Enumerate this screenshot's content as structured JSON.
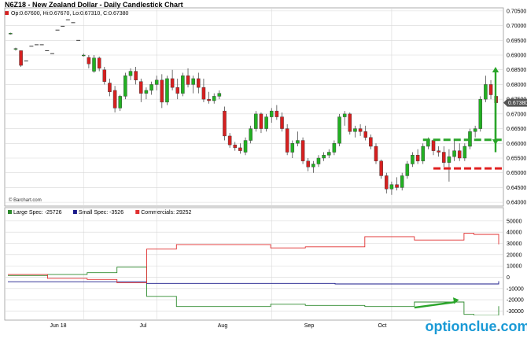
{
  "header": {
    "title": "N6Z18 - New Zealand Dollar - Daily Candlestick Chart",
    "ohlc": "Op:0.67600, Hi:0.67670, Lo:0.67310, C:0.67380"
  },
  "credit": "© Barchart.com",
  "watermark": {
    "main": "optionclue",
    "dot": ".",
    "tld": "com"
  },
  "colors": {
    "up": "#22b022",
    "down": "#d62020",
    "grid": "#d8d8d8",
    "large": "#2d8a2d",
    "small": "#1a1a8a",
    "commercials": "#e03030",
    "annotation_green": "#2aa52a",
    "annotation_red": "#e02020",
    "badge": "#555555"
  },
  "chart_data": [
    {
      "type": "candlestick",
      "title": "N6Z18 - New Zealand Dollar - Daily Candlestick Chart",
      "x_ticks": [
        "Jun 18",
        "Jul",
        "Aug",
        "Sep",
        "Oct"
      ],
      "y_ticks": [
        "0.70500",
        "0.70000",
        "0.69500",
        "0.69000",
        "0.68500",
        "0.68000",
        "0.67500",
        "0.67000",
        "0.66500",
        "0.66000",
        "0.65500",
        "0.65000",
        "0.64500",
        "0.64000"
      ],
      "ylim": [
        0.6395,
        0.7055
      ],
      "last_price": "0.67380",
      "candles": [
        {
          "o": 0.6972,
          "h": 0.6976,
          "l": 0.697,
          "c": 0.6974
        },
        {
          "o": 0.692,
          "h": 0.6925,
          "l": 0.6915,
          "c": 0.6922
        },
        {
          "o": 0.6915,
          "h": 0.6915,
          "l": 0.686,
          "c": 0.6865
        },
        {
          "o": 0.688,
          "h": 0.6882,
          "l": 0.6878,
          "c": 0.688
        },
        {
          "o": 0.693,
          "h": 0.6932,
          "l": 0.6928,
          "c": 0.693
        },
        {
          "o": 0.6935,
          "h": 0.6937,
          "l": 0.6933,
          "c": 0.6935
        },
        {
          "o": 0.6935,
          "h": 0.6937,
          "l": 0.6933,
          "c": 0.6935
        },
        {
          "o": 0.6915,
          "h": 0.6917,
          "l": 0.6913,
          "c": 0.6915
        },
        {
          "o": 0.6905,
          "h": 0.6907,
          "l": 0.6903,
          "c": 0.6905
        },
        {
          "o": 0.6985,
          "h": 0.6987,
          "l": 0.6983,
          "c": 0.6985
        },
        {
          "o": 0.6998,
          "h": 0.7,
          "l": 0.6996,
          "c": 0.6998
        },
        {
          "o": 0.702,
          "h": 0.7022,
          "l": 0.7018,
          "c": 0.702
        },
        {
          "o": 0.701,
          "h": 0.7012,
          "l": 0.7008,
          "c": 0.701
        },
        {
          "o": 0.695,
          "h": 0.6952,
          "l": 0.6948,
          "c": 0.695
        },
        {
          "o": 0.69,
          "h": 0.6905,
          "l": 0.6895,
          "c": 0.69
        },
        {
          "o": 0.6892,
          "h": 0.69,
          "l": 0.6855,
          "c": 0.687
        },
        {
          "o": 0.6845,
          "h": 0.69,
          "l": 0.684,
          "c": 0.689
        },
        {
          "o": 0.689,
          "h": 0.6895,
          "l": 0.6845,
          "c": 0.6855
        },
        {
          "o": 0.685,
          "h": 0.686,
          "l": 0.68,
          "c": 0.681
        },
        {
          "o": 0.6805,
          "h": 0.682,
          "l": 0.676,
          "c": 0.6775
        },
        {
          "o": 0.678,
          "h": 0.6795,
          "l": 0.6705,
          "c": 0.672
        },
        {
          "o": 0.672,
          "h": 0.6765,
          "l": 0.671,
          "c": 0.676
        },
        {
          "o": 0.676,
          "h": 0.684,
          "l": 0.675,
          "c": 0.683
        },
        {
          "o": 0.683,
          "h": 0.6855,
          "l": 0.6815,
          "c": 0.6845
        },
        {
          "o": 0.6845,
          "h": 0.686,
          "l": 0.68,
          "c": 0.6815
        },
        {
          "o": 0.681,
          "h": 0.682,
          "l": 0.674,
          "c": 0.677
        },
        {
          "o": 0.677,
          "h": 0.679,
          "l": 0.675,
          "c": 0.678
        },
        {
          "o": 0.678,
          "h": 0.681,
          "l": 0.6765,
          "c": 0.68
        },
        {
          "o": 0.68,
          "h": 0.683,
          "l": 0.678,
          "c": 0.6815
        },
        {
          "o": 0.6815,
          "h": 0.6835,
          "l": 0.672,
          "c": 0.674
        },
        {
          "o": 0.674,
          "h": 0.683,
          "l": 0.673,
          "c": 0.682
        },
        {
          "o": 0.682,
          "h": 0.685,
          "l": 0.678,
          "c": 0.679
        },
        {
          "o": 0.679,
          "h": 0.682,
          "l": 0.675,
          "c": 0.677
        },
        {
          "o": 0.677,
          "h": 0.684,
          "l": 0.676,
          "c": 0.683
        },
        {
          "o": 0.683,
          "h": 0.6855,
          "l": 0.679,
          "c": 0.68
        },
        {
          "o": 0.68,
          "h": 0.683,
          "l": 0.677,
          "c": 0.682
        },
        {
          "o": 0.682,
          "h": 0.684,
          "l": 0.677,
          "c": 0.679
        },
        {
          "o": 0.679,
          "h": 0.682,
          "l": 0.674,
          "c": 0.675
        },
        {
          "o": 0.675,
          "h": 0.6775,
          "l": 0.6735,
          "c": 0.6745
        },
        {
          "o": 0.6745,
          "h": 0.677,
          "l": 0.6735,
          "c": 0.676
        },
        {
          "o": 0.676,
          "h": 0.678,
          "l": 0.675,
          "c": 0.677
        },
        {
          "o": 0.671,
          "h": 0.6725,
          "l": 0.661,
          "c": 0.6625
        },
        {
          "o": 0.6625,
          "h": 0.6635,
          "l": 0.6585,
          "c": 0.6595
        },
        {
          "o": 0.6595,
          "h": 0.6605,
          "l": 0.6575,
          "c": 0.6585
        },
        {
          "o": 0.6585,
          "h": 0.66,
          "l": 0.6565,
          "c": 0.6575
        },
        {
          "o": 0.657,
          "h": 0.662,
          "l": 0.656,
          "c": 0.661
        },
        {
          "o": 0.661,
          "h": 0.666,
          "l": 0.66,
          "c": 0.665
        },
        {
          "o": 0.665,
          "h": 0.671,
          "l": 0.664,
          "c": 0.67
        },
        {
          "o": 0.67,
          "h": 0.6705,
          "l": 0.6635,
          "c": 0.665
        },
        {
          "o": 0.665,
          "h": 0.67,
          "l": 0.664,
          "c": 0.669
        },
        {
          "o": 0.669,
          "h": 0.672,
          "l": 0.667,
          "c": 0.671
        },
        {
          "o": 0.671,
          "h": 0.673,
          "l": 0.668,
          "c": 0.669
        },
        {
          "o": 0.669,
          "h": 0.6705,
          "l": 0.664,
          "c": 0.665
        },
        {
          "o": 0.665,
          "h": 0.6665,
          "l": 0.656,
          "c": 0.657
        },
        {
          "o": 0.657,
          "h": 0.661,
          "l": 0.655,
          "c": 0.66
        },
        {
          "o": 0.66,
          "h": 0.664,
          "l": 0.659,
          "c": 0.661
        },
        {
          "o": 0.661,
          "h": 0.662,
          "l": 0.653,
          "c": 0.654
        },
        {
          "o": 0.654,
          "h": 0.655,
          "l": 0.6505,
          "c": 0.652
        },
        {
          "o": 0.652,
          "h": 0.654,
          "l": 0.65,
          "c": 0.653
        },
        {
          "o": 0.653,
          "h": 0.656,
          "l": 0.652,
          "c": 0.655
        },
        {
          "o": 0.655,
          "h": 0.657,
          "l": 0.654,
          "c": 0.656
        },
        {
          "o": 0.656,
          "h": 0.658,
          "l": 0.655,
          "c": 0.657
        },
        {
          "o": 0.657,
          "h": 0.661,
          "l": 0.656,
          "c": 0.66
        },
        {
          "o": 0.66,
          "h": 0.67,
          "l": 0.659,
          "c": 0.669
        },
        {
          "o": 0.669,
          "h": 0.671,
          "l": 0.666,
          "c": 0.67
        },
        {
          "o": 0.67,
          "h": 0.6705,
          "l": 0.663,
          "c": 0.664
        },
        {
          "o": 0.664,
          "h": 0.666,
          "l": 0.662,
          "c": 0.665
        },
        {
          "o": 0.665,
          "h": 0.6665,
          "l": 0.6625,
          "c": 0.664
        },
        {
          "o": 0.664,
          "h": 0.666,
          "l": 0.661,
          "c": 0.662
        },
        {
          "o": 0.662,
          "h": 0.663,
          "l": 0.658,
          "c": 0.659
        },
        {
          "o": 0.659,
          "h": 0.66,
          "l": 0.653,
          "c": 0.654
        },
        {
          "o": 0.654,
          "h": 0.6545,
          "l": 0.648,
          "c": 0.649
        },
        {
          "o": 0.649,
          "h": 0.65,
          "l": 0.643,
          "c": 0.6445
        },
        {
          "o": 0.6445,
          "h": 0.647,
          "l": 0.6425,
          "c": 0.646
        },
        {
          "o": 0.646,
          "h": 0.6485,
          "l": 0.644,
          "c": 0.645
        },
        {
          "o": 0.645,
          "h": 0.65,
          "l": 0.644,
          "c": 0.649
        },
        {
          "o": 0.649,
          "h": 0.654,
          "l": 0.648,
          "c": 0.653
        },
        {
          "o": 0.653,
          "h": 0.657,
          "l": 0.652,
          "c": 0.656
        },
        {
          "o": 0.656,
          "h": 0.658,
          "l": 0.653,
          "c": 0.654
        },
        {
          "o": 0.654,
          "h": 0.66,
          "l": 0.653,
          "c": 0.659
        },
        {
          "o": 0.659,
          "h": 0.662,
          "l": 0.658,
          "c": 0.661
        },
        {
          "o": 0.661,
          "h": 0.6615,
          "l": 0.656,
          "c": 0.6575
        },
        {
          "o": 0.6575,
          "h": 0.659,
          "l": 0.6555,
          "c": 0.657
        },
        {
          "o": 0.657,
          "h": 0.659,
          "l": 0.652,
          "c": 0.6535
        },
        {
          "o": 0.6535,
          "h": 0.658,
          "l": 0.647,
          "c": 0.6555
        },
        {
          "o": 0.6555,
          "h": 0.661,
          "l": 0.654,
          "c": 0.6575
        },
        {
          "o": 0.6575,
          "h": 0.66,
          "l": 0.654,
          "c": 0.655
        },
        {
          "o": 0.655,
          "h": 0.66,
          "l": 0.654,
          "c": 0.659
        },
        {
          "o": 0.659,
          "h": 0.665,
          "l": 0.658,
          "c": 0.664
        },
        {
          "o": 0.664,
          "h": 0.666,
          "l": 0.662,
          "c": 0.665
        },
        {
          "o": 0.665,
          "h": 0.676,
          "l": 0.664,
          "c": 0.675
        },
        {
          "o": 0.675,
          "h": 0.683,
          "l": 0.674,
          "c": 0.68
        },
        {
          "o": 0.68,
          "h": 0.6815,
          "l": 0.675,
          "c": 0.6765
        },
        {
          "o": 0.676,
          "h": 0.6767,
          "l": 0.6731,
          "c": 0.6738
        }
      ],
      "annotations": [
        {
          "type": "dashed-level",
          "color": "green",
          "value": 0.6612,
          "from_index": 79,
          "to_index": 97
        },
        {
          "type": "dashed-level",
          "color": "red",
          "value": 0.6515,
          "from_index": 81,
          "to_index": 97
        },
        {
          "type": "arrow-up",
          "color": "green",
          "value_from": 0.657,
          "value_to": 0.686,
          "at_index": 96
        },
        {
          "type": "arrow-down",
          "color": "green",
          "value_from": 0.676,
          "value_to": 0.6595,
          "at_index": 95
        }
      ]
    },
    {
      "type": "line",
      "legend": [
        {
          "label": "Large Spec: -25726",
          "color": "#2d8a2d"
        },
        {
          "label": "Small Spec: -3526",
          "color": "#1a1a8a"
        },
        {
          "label": "Commercials: 29252",
          "color": "#e03030"
        }
      ],
      "y_ticks": [
        "50000",
        "40000",
        "30000",
        "20000",
        "10000",
        "0",
        "-10000",
        "-20000",
        "-30000"
      ],
      "ylim": [
        -36000,
        52000
      ],
      "x_count": 100,
      "series": [
        {
          "name": "Large Spec",
          "color": "#2d8a2d",
          "points": [
            [
              0,
              1500
            ],
            [
              8,
              1500
            ],
            [
              8,
              2500
            ],
            [
              16,
              2500
            ],
            [
              16,
              4000
            ],
            [
              22,
              4000
            ],
            [
              22,
              9000
            ],
            [
              28,
              9000
            ],
            [
              28,
              -17000
            ],
            [
              34,
              -17000
            ],
            [
              34,
              -26000
            ],
            [
              53,
              -26000
            ],
            [
              53,
              -24000
            ],
            [
              60,
              -24000
            ],
            [
              60,
              -25000
            ],
            [
              72,
              -25000
            ],
            [
              72,
              -26000
            ],
            [
              82,
              -26000
            ],
            [
              82,
              -22000
            ],
            [
              92,
              -22000
            ],
            [
              92,
              -33000
            ],
            [
              94,
              -33000
            ],
            [
              94,
              -34000
            ],
            [
              99,
              -34000
            ],
            [
              99,
              -25726
            ]
          ]
        },
        {
          "name": "Small Spec",
          "color": "#1a1a8a",
          "points": [
            [
              0,
              -4000
            ],
            [
              28,
              -4000
            ],
            [
              28,
              -5500
            ],
            [
              66,
              -5500
            ],
            [
              66,
              -6000
            ],
            [
              99,
              -6000
            ],
            [
              99,
              -3526
            ]
          ]
        },
        {
          "name": "Commercials",
          "color": "#e03030",
          "points": [
            [
              0,
              2500
            ],
            [
              8,
              2500
            ],
            [
              8,
              -1000
            ],
            [
              16,
              -1000
            ],
            [
              16,
              -2000
            ],
            [
              22,
              -2000
            ],
            [
              22,
              -5000
            ],
            [
              28,
              -5000
            ],
            [
              28,
              25000
            ],
            [
              34,
              25000
            ],
            [
              34,
              29000
            ],
            [
              53,
              29000
            ],
            [
              53,
              26000
            ],
            [
              60,
              26000
            ],
            [
              60,
              27000
            ],
            [
              72,
              27000
            ],
            [
              72,
              36000
            ],
            [
              82,
              36000
            ],
            [
              82,
              33000
            ],
            [
              92,
              33000
            ],
            [
              92,
              39000
            ],
            [
              94,
              39000
            ],
            [
              94,
              38000
            ],
            [
              99,
              38000
            ],
            [
              99,
              29252
            ]
          ]
        }
      ],
      "annotations": [
        {
          "type": "arrow-up",
          "color": "green",
          "from_x": 82,
          "from_y": -27000,
          "to_x": 91,
          "to_y": -20000
        }
      ]
    }
  ]
}
